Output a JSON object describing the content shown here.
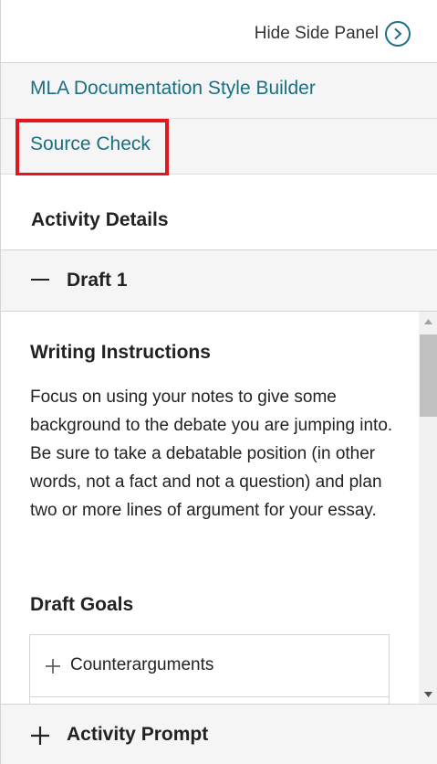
{
  "header": {
    "hide_label": "Hide Side Panel",
    "hide_icon": "chevron-right-circle-icon"
  },
  "nav": {
    "mla_label": "MLA Documentation Style Builder",
    "source_label": "Source Check"
  },
  "activity": {
    "title": "Activity Details",
    "draft_label": "Draft 1",
    "draft_icon": "minus-icon"
  },
  "instructions": {
    "title": "Writing Instructions",
    "text": "Focus on using your notes to give some background to the debate you are jumping into. Be sure to take a debatable position (in other words, not a fact and not a question) and plan two or more lines of argument for your essay."
  },
  "goals": {
    "title": "Draft Goals",
    "items": [
      {
        "label": "Counterarguments",
        "icon": "plus-icon"
      }
    ]
  },
  "prompt": {
    "label": "Activity Prompt",
    "icon": "plus-icon"
  },
  "colors": {
    "link": "#1a6f82",
    "highlight": "#e3161e",
    "row_bg": "#f5f5f5"
  }
}
